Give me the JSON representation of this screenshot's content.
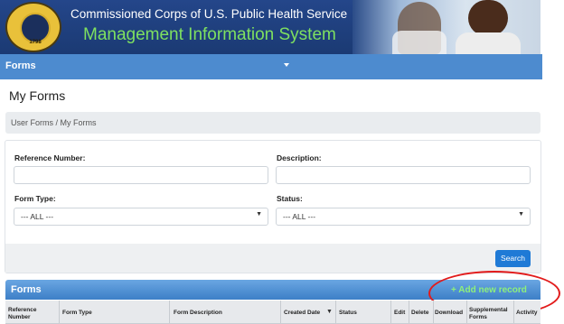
{
  "header": {
    "title_line1": "Commissioned Corps of U.S. Public Health Service",
    "title_line2": "Management Information System",
    "seal_text": "1798"
  },
  "nav": {
    "menu_label": "Forms"
  },
  "page": {
    "title": "My Forms"
  },
  "breadcrumb": {
    "text": "User Forms  /  My Forms"
  },
  "search": {
    "reference_label": "Reference Number:",
    "reference_value": "",
    "description_label": "Description:",
    "description_value": "",
    "form_type_label": "Form Type:",
    "form_type_selected": "--- ALL ---",
    "status_label": "Status:",
    "status_selected": "--- ALL ---",
    "search_button": "Search"
  },
  "grid": {
    "title": "Forms",
    "add_label": "+ Add new record",
    "columns": {
      "reference": "Reference",
      "number": "Number",
      "form_type": "Form Type",
      "form_description": "Form Description",
      "created_date": "Created Date",
      "status": "Status",
      "edit": "Edit",
      "delete": "Delete",
      "download": "Download",
      "supplemental": "Supplemental",
      "forms": "Forms",
      "activity": "Activity"
    }
  },
  "colors": {
    "banner": "#1d3c78",
    "nav": "#4d8bcf",
    "title_green": "#7ee060",
    "add_green": "#8ef07a",
    "button_blue": "#1f7ad6",
    "highlight_red": "#e21b1b"
  }
}
